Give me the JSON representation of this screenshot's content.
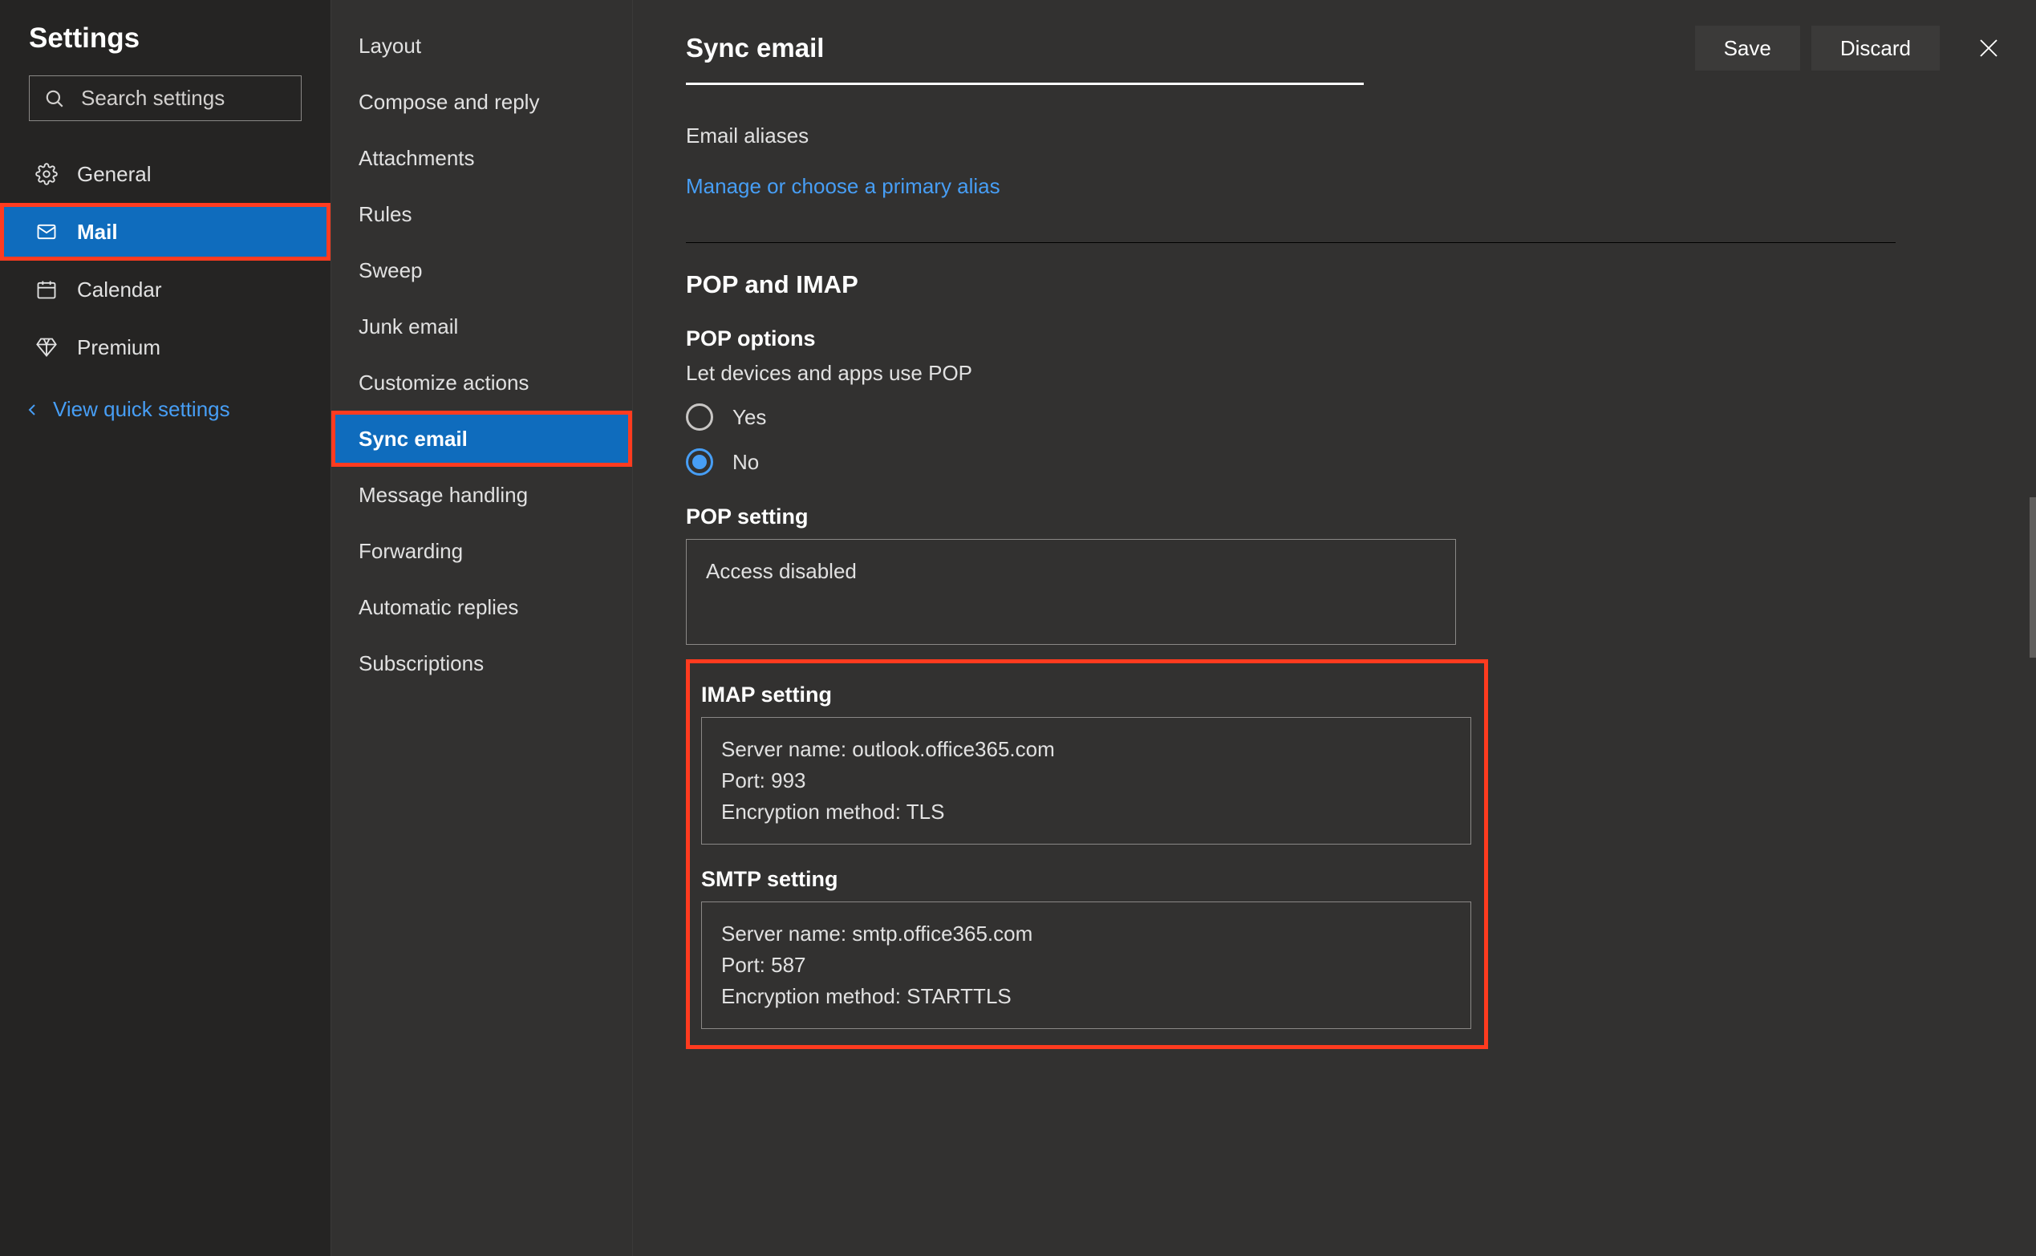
{
  "sidebar": {
    "title": "Settings",
    "search_placeholder": "Search settings",
    "items": [
      {
        "label": "General",
        "icon": "gear"
      },
      {
        "label": "Mail",
        "icon": "mail",
        "active": true,
        "highlighted": true
      },
      {
        "label": "Calendar",
        "icon": "calendar"
      },
      {
        "label": "Premium",
        "icon": "diamond"
      }
    ],
    "quick_link": "View quick settings"
  },
  "submenu": {
    "items": [
      {
        "label": "Layout"
      },
      {
        "label": "Compose and reply"
      },
      {
        "label": "Attachments"
      },
      {
        "label": "Rules"
      },
      {
        "label": "Sweep"
      },
      {
        "label": "Junk email"
      },
      {
        "label": "Customize actions"
      },
      {
        "label": "Sync email",
        "active": true,
        "highlighted": true
      },
      {
        "label": "Message handling"
      },
      {
        "label": "Forwarding"
      },
      {
        "label": "Automatic replies"
      },
      {
        "label": "Subscriptions"
      }
    ]
  },
  "header": {
    "title": "Sync email",
    "save": "Save",
    "discard": "Discard"
  },
  "email_aliases": {
    "label": "Email aliases",
    "link": "Manage or choose a primary alias"
  },
  "pop_imap": {
    "section_title": "POP and IMAP",
    "pop_options_title": "POP options",
    "pop_options_label": "Let devices and apps use POP",
    "radio_yes": "Yes",
    "radio_no": "No",
    "radio_selected": "no",
    "pop_setting_title": "POP setting",
    "pop_setting_value": "Access disabled",
    "imap_title": "IMAP setting",
    "imap_box": "Server name: outlook.office365.com\nPort: 993\nEncryption method: TLS",
    "smtp_title": "SMTP setting",
    "smtp_box": "Server name: smtp.office365.com\nPort: 587\nEncryption method: STARTTLS"
  }
}
